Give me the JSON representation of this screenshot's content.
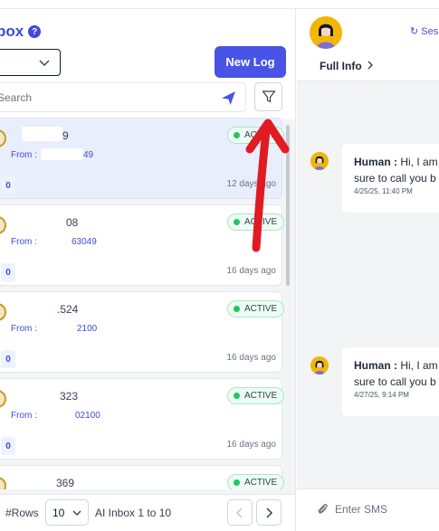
{
  "header": {
    "title": "box",
    "help_icon": "?"
  },
  "toolbar": {
    "new_log_label": "New Log"
  },
  "search": {
    "placeholder": "Search"
  },
  "conversations": [
    {
      "name": "9",
      "from_label": "From :",
      "from_number": "49",
      "count": "0",
      "status": "ACTIVE",
      "ago": "12 days ago",
      "selected": true
    },
    {
      "name": "08",
      "from_label": "From :",
      "from_number": "63049",
      "count": "0",
      "status": "ACTIVE",
      "ago": "16 days ago",
      "selected": false
    },
    {
      "name": ".524",
      "from_label": "From :",
      "from_number": "2100",
      "count": "0",
      "status": "ACTIVE",
      "ago": "16 days ago",
      "selected": false
    },
    {
      "name": "323",
      "from_label": "From :",
      "from_number": "02100",
      "count": "0",
      "status": "ACTIVE",
      "ago": "16 days ago",
      "selected": false
    },
    {
      "name": "369",
      "from_label": "",
      "from_number": "",
      "count": "",
      "status": "ACTIVE",
      "ago": "",
      "selected": false
    }
  ],
  "pagination": {
    "rows_label": "#Rows",
    "rows_value": "10",
    "info": "AI Inbox 1 to 10"
  },
  "contact": {
    "sessions_label": "Ses",
    "full_info_label": "Full Info"
  },
  "messages": [
    {
      "sender": "Human :",
      "line1": " Hi, I am",
      "line2": "sure to call you b",
      "time": "4/25/25, 11:40 PM"
    },
    {
      "sender": "Human :",
      "line1": " Hi, I am",
      "line2": "sure to call you b",
      "time": "4/27/25, 9:14 PM"
    }
  ],
  "composer": {
    "placeholder": "Enter SMS"
  },
  "colors": {
    "accent": "#4754e6",
    "active_dot": "#22c55e",
    "annotation_arrow": "#e01b24"
  }
}
